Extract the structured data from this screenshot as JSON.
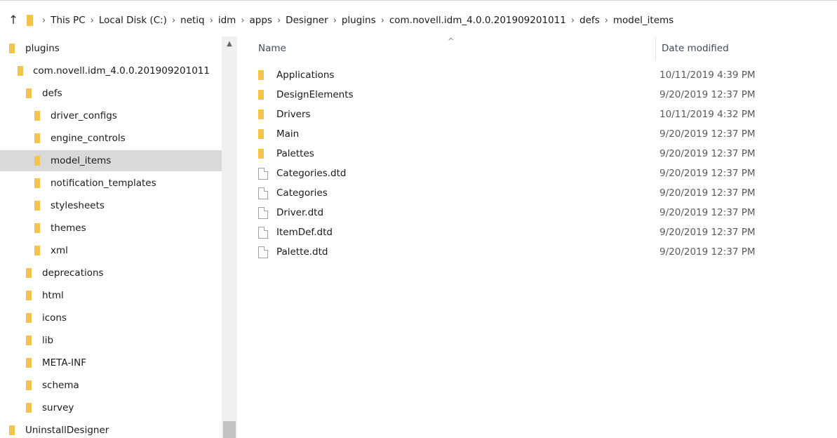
{
  "address": {
    "up_icon": "up-arrow-icon",
    "crumbs": [
      "This PC",
      "Local Disk (C:)",
      "netiq",
      "idm",
      "apps",
      "Designer",
      "plugins",
      "com.novell.idm_4.0.0.201909201011",
      "defs",
      "model_items"
    ]
  },
  "nav": {
    "items": [
      {
        "label": "plugins"
      },
      {
        "label": "com.novell.idm_4.0.0.201909201011"
      },
      {
        "label": "defs"
      },
      {
        "label": "driver_configs"
      },
      {
        "label": "engine_controls"
      },
      {
        "label": "model_items",
        "selected": true
      },
      {
        "label": "notification_templates"
      },
      {
        "label": "stylesheets"
      },
      {
        "label": "themes"
      },
      {
        "label": "xml"
      },
      {
        "label": "deprecations"
      },
      {
        "label": "html"
      },
      {
        "label": "icons"
      },
      {
        "label": "lib"
      },
      {
        "label": "META-INF"
      },
      {
        "label": "schema"
      },
      {
        "label": "survey"
      },
      {
        "label": "UninstallDesigner"
      }
    ]
  },
  "content": {
    "columns": {
      "name": "Name",
      "date": "Date modified"
    },
    "files": [
      {
        "name": "Applications",
        "date": "10/11/2019 4:39 PM",
        "type": "folder"
      },
      {
        "name": "DesignElements",
        "date": "9/20/2019 12:37 PM",
        "type": "folder"
      },
      {
        "name": "Drivers",
        "date": "10/11/2019 4:32 PM",
        "type": "folder"
      },
      {
        "name": "Main",
        "date": "9/20/2019 12:37 PM",
        "type": "folder"
      },
      {
        "name": "Palettes",
        "date": "9/20/2019 12:37 PM",
        "type": "folder"
      },
      {
        "name": "Categories.dtd",
        "date": "9/20/2019 12:37 PM",
        "type": "file"
      },
      {
        "name": "Categories",
        "date": "9/20/2019 12:37 PM",
        "type": "file"
      },
      {
        "name": "Driver.dtd",
        "date": "9/20/2019 12:37 PM",
        "type": "file"
      },
      {
        "name": "ItemDef.dtd",
        "date": "9/20/2019 12:37 PM",
        "type": "file"
      },
      {
        "name": "Palette.dtd",
        "date": "9/20/2019 12:37 PM",
        "type": "file"
      }
    ]
  },
  "colors": {
    "folder": "#f2c34d",
    "selection": "#d9d9d9"
  }
}
